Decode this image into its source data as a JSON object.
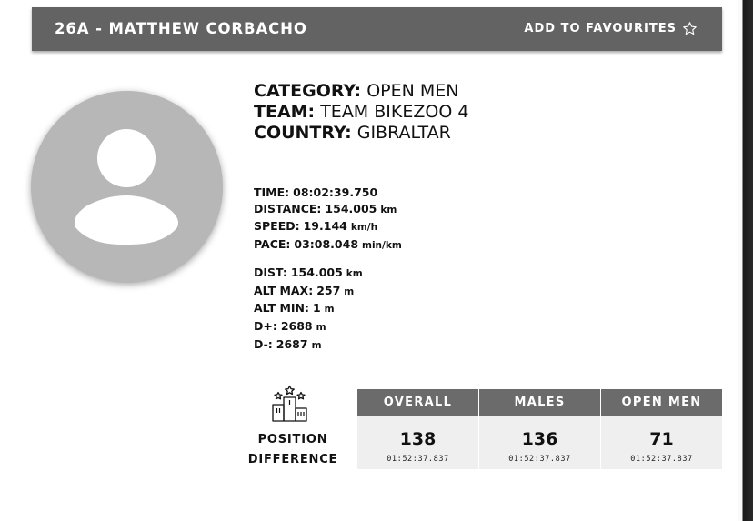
{
  "header": {
    "title": "26A  -  MATTHEW CORBACHO",
    "favourite_label": "ADD TO FAVOURITES"
  },
  "profile": {
    "category_label": "CATEGORY:",
    "category": "OPEN MEN",
    "team_label": "TEAM:",
    "team": "TEAM BIKEZOO 4",
    "country_label": "COUNTRY:",
    "country": "GIBRALTAR"
  },
  "stats": {
    "time_label": "TIME:",
    "time": "08:02:39.750",
    "distance_label": "DISTANCE:",
    "distance": "154.005",
    "distance_unit": "km",
    "speed_label": "SPEED:",
    "speed": "19.144",
    "speed_unit": "km/h",
    "pace_label": "PACE:",
    "pace": "03:08.048",
    "pace_unit": "min/km"
  },
  "altitude": {
    "dist_label": "DIST:",
    "dist": "154.005",
    "dist_unit": "km",
    "alt_max_label": "ALT MAX:",
    "alt_max": "257",
    "alt_max_unit": "m",
    "alt_min_label": "ALT MIN:",
    "alt_min": "1",
    "alt_min_unit": "m",
    "d_plus_label": "D+:",
    "d_plus": "2688",
    "d_plus_unit": "m",
    "d_minus_label": "D-:",
    "d_minus": "2687",
    "d_minus_unit": "m"
  },
  "ranking": {
    "position_label": "POSITION",
    "difference_label": "DIFFERENCE",
    "columns": [
      {
        "header": "OVERALL",
        "position": "138",
        "difference": "01:52:37.837"
      },
      {
        "header": "MALES",
        "position": "136",
        "difference": "01:52:37.837"
      },
      {
        "header": "OPEN MEN",
        "position": "71",
        "difference": "01:52:37.837"
      }
    ]
  },
  "icons": {
    "favourite": "star-outline-icon",
    "avatar": "user-placeholder-icon",
    "podium": "podium-stars-icon"
  },
  "colors": {
    "header_bg": "#636363",
    "table_header_bg": "#6b6b6b",
    "table_cell_bg": "#efefef",
    "avatar_bg": "#b7b7b7"
  }
}
